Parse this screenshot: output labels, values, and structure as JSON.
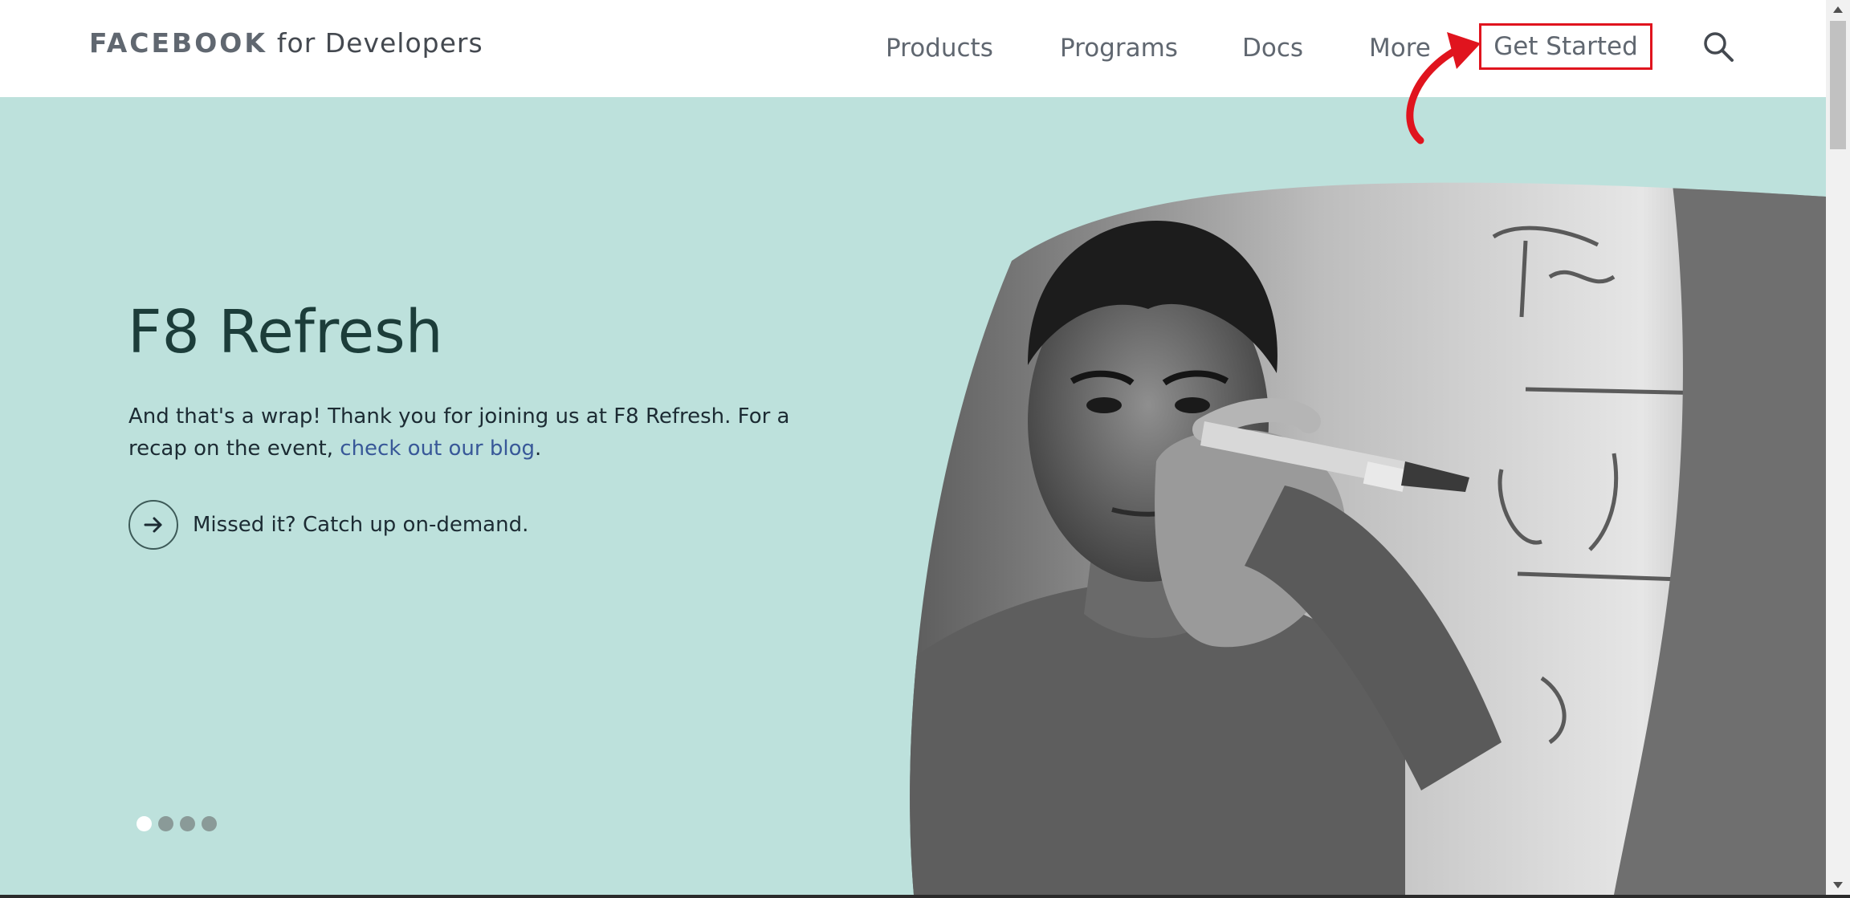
{
  "nav": {
    "brand": "FACEBOOK",
    "brand_suffix": "for Developers",
    "links": [
      "Products",
      "Programs",
      "Docs",
      "More"
    ],
    "get_started": "Get Started",
    "search_icon": "search-icon"
  },
  "hero": {
    "title": "F8 Refresh",
    "body": "And that's a wrap! Thank you for joining us at F8 Refresh. For a recap on the event, ",
    "link_text": "check out our blog",
    "body_end": ".",
    "cta_text": "Missed it? Catch up on-demand.",
    "cta_icon": "arrow-right-icon",
    "carousel": {
      "slides": 4,
      "active": 1
    },
    "photo": "grayscale-photo-person-writing-on-whiteboard",
    "colors": {
      "background": "#bde1dc",
      "title": "#1c3d3a",
      "link": "#385898"
    }
  },
  "annotation": {
    "highlight_color": "#e0141e",
    "arrow": "curved-red-arrow-icon"
  }
}
